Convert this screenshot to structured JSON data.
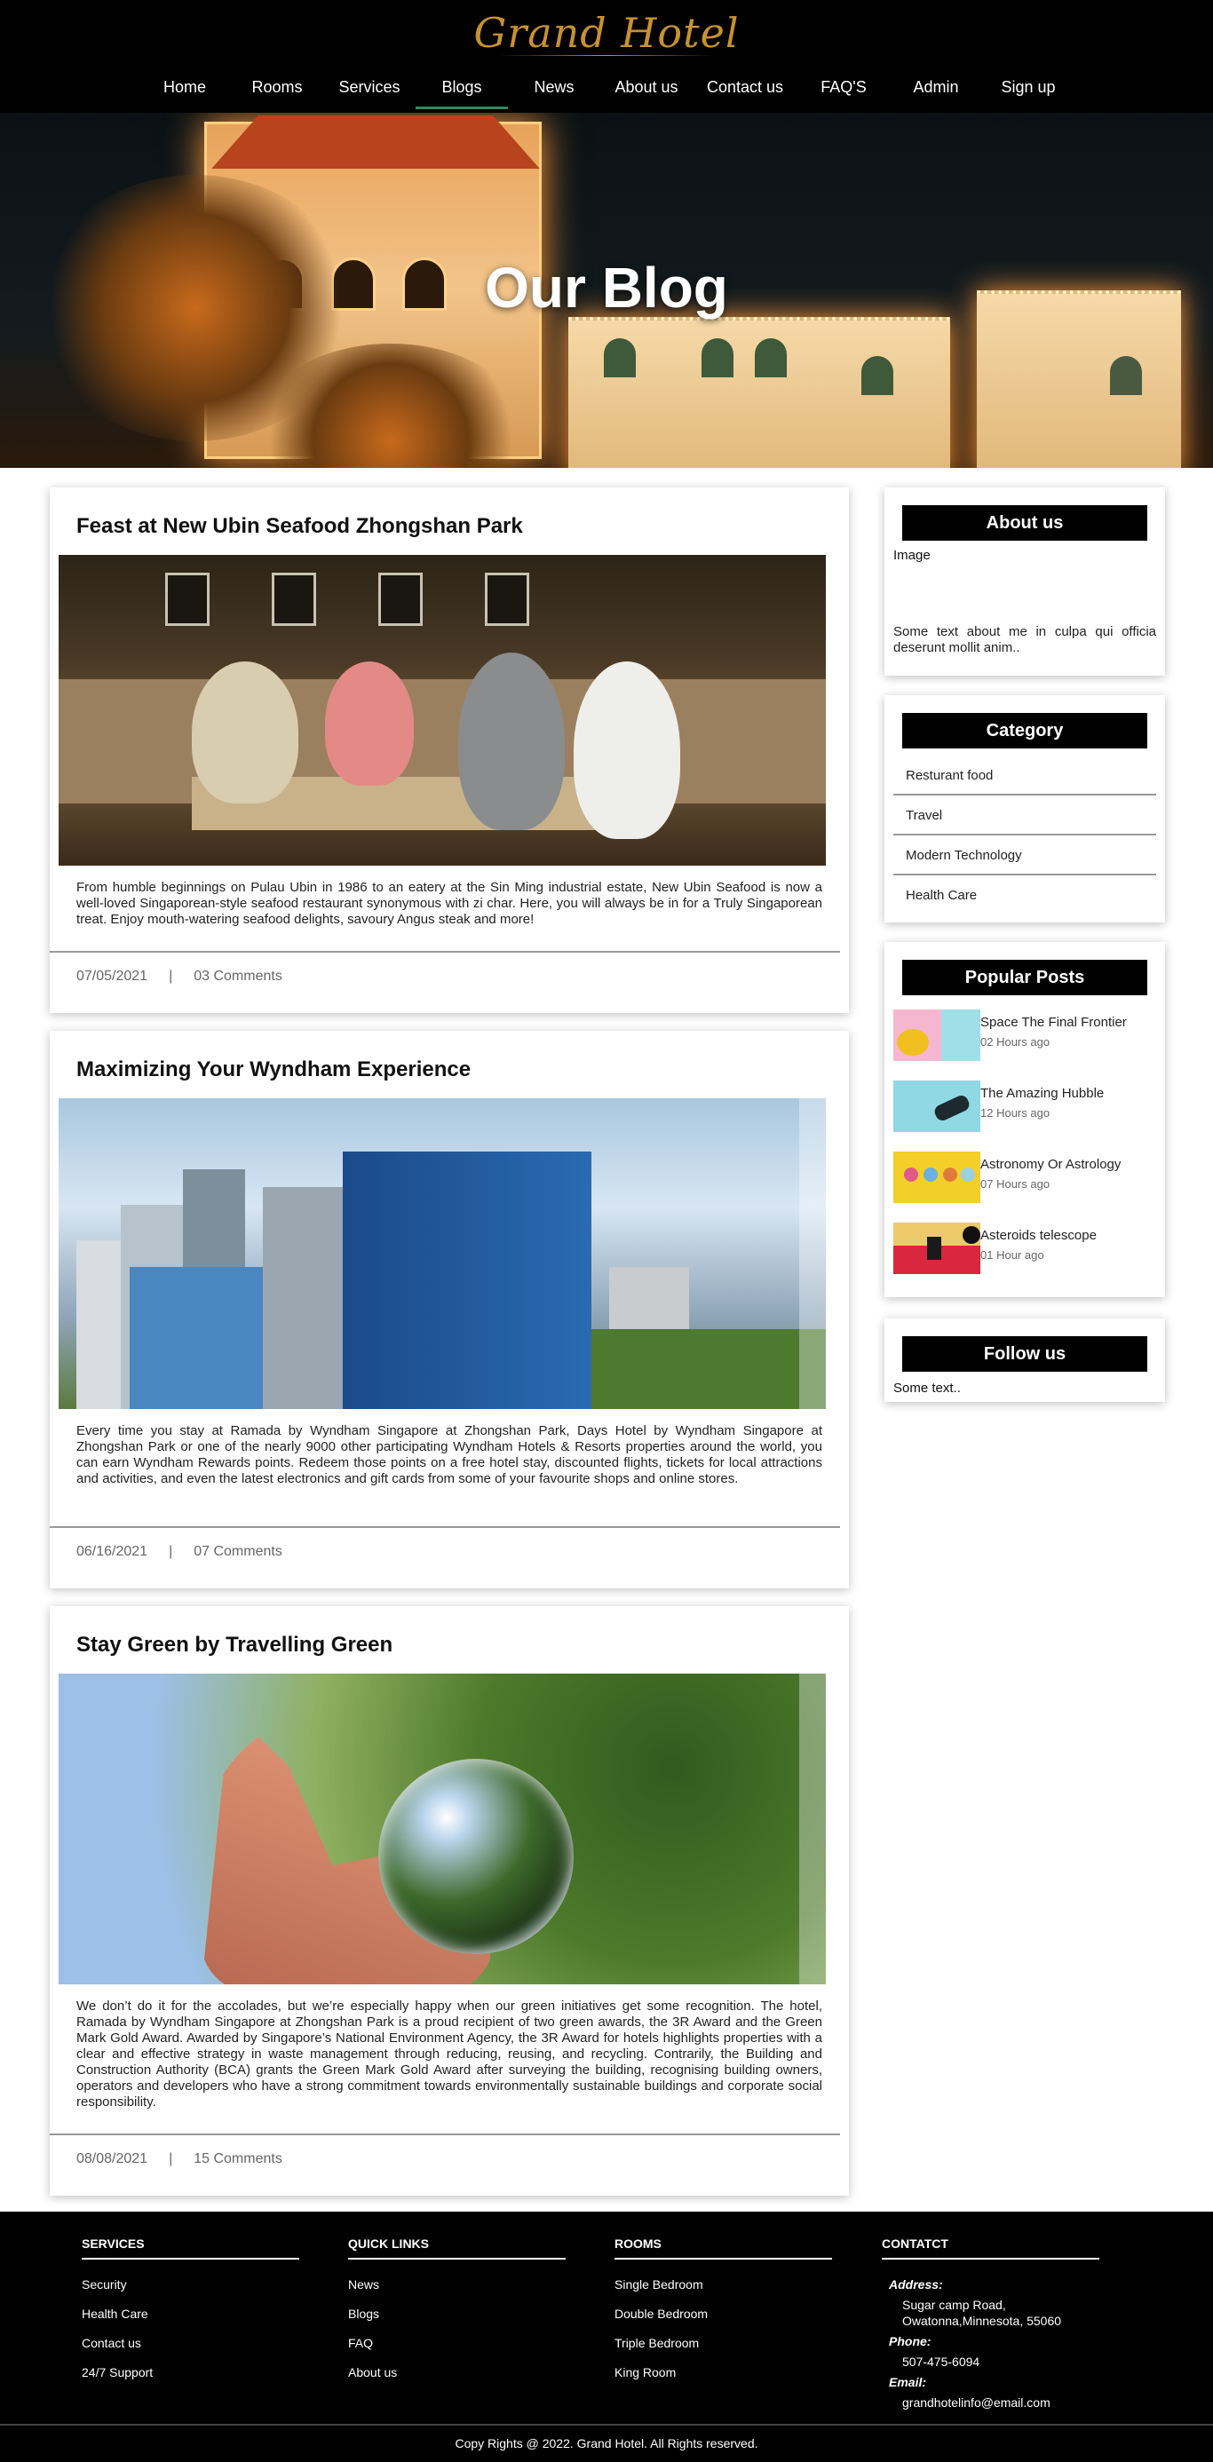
{
  "header": {
    "logo": "Grand Hotel",
    "nav": [
      "Home",
      "Rooms",
      "Services",
      "Blogs",
      "News",
      "About us",
      "Contact us",
      "FAQ'S",
      "Admin",
      "Sign up"
    ],
    "active_nav": "Blogs",
    "accent": "#2e8b57",
    "logo_color": "#c8912f"
  },
  "hero": {
    "title": "Our Blog"
  },
  "posts": [
    {
      "title": "Feast at New Ubin Seafood Zhongshan Park",
      "image_icon": "restaurant-dining-photo",
      "text": "From humble beginnings on Pulau Ubin in 1986 to an eatery at the Sin Ming industrial estate, New Ubin Seafood is now a well-loved Singaporean-style seafood restaurant synonymous with zi char. Here, you will always be in for a Truly Singaporean treat. Enjoy mouth-watering seafood delights, savoury Angus steak and more!",
      "date": "07/05/2021",
      "sep": "|",
      "comments": "03 Comments"
    },
    {
      "title": "Maximizing Your Wyndham Experience",
      "image_icon": "city-hotel-photo",
      "text": "Every time you stay at Ramada by Wyndham Singapore at Zhongshan Park, Days Hotel by Wyndham Singapore at Zhongshan Park or one of the nearly 9000 other participating Wyndham Hotels & Resorts properties around the world, you can earn Wyndham Rewards points. Redeem those points on a free hotel stay, discounted flights, tickets for local attractions and activities, and even the latest electronics and gift cards from some of your favourite shops and online stores.",
      "date": "06/16/2021",
      "sep": "|",
      "comments": "07 Comments"
    },
    {
      "title": "Stay Green by Travelling Green",
      "image_icon": "glass-ball-nature-photo",
      "text": "We don’t do it for the accolades, but we’re especially happy when our green initiatives get some recognition. The hotel, Ramada by Wyndham Singapore at Zhongshan Park is a proud recipient of two green awards, the 3R Award and the Green Mark Gold Award. Awarded by Singapore’s National Environment Agency, the 3R Award for hotels highlights properties with a clear and effective strategy in waste management through reducing, reusing, and recycling. Contrarily, the Building and Construction Authority (BCA) grants the Green Mark Gold Award after surveying the building, recognising building owners, operators and developers who have a strong commitment towards environmentally sustainable buildings and corporate social responsibility.",
      "date": "08/08/2021",
      "sep": "|",
      "comments": "15 Comments"
    }
  ],
  "sidebar": {
    "about": {
      "title": "About us",
      "image_label": "Image",
      "text": "Some text about me in culpa qui officia deserunt mollit anim.."
    },
    "category": {
      "title": "Category",
      "items": [
        "Resturant food",
        "Travel",
        "Modern Technology",
        "Health Care"
      ]
    },
    "popular": {
      "title": "Popular Posts",
      "items": [
        {
          "title": "Space The Final Frontier",
          "time": "02 Hours ago",
          "thumb": "desk-headphones-photo"
        },
        {
          "title": "The Amazing Hubble",
          "time": "12 Hours ago",
          "thumb": "car-toy-photo"
        },
        {
          "title": "Astronomy Or Astrology",
          "time": "07 Hours ago",
          "thumb": "lollipops-photo"
        },
        {
          "title": "Asteroids telescope",
          "time": "01 Hour ago",
          "thumb": "phone-flatlay-photo"
        }
      ]
    },
    "follow": {
      "title": "Follow us",
      "text": "Some text.."
    }
  },
  "footer": {
    "services": {
      "title": "SERVICES",
      "items": [
        "Security",
        "Health Care",
        "Contact us",
        "24/7 Support"
      ]
    },
    "quick_links": {
      "title": "QUICK LINKS",
      "items": [
        "News",
        "Blogs",
        "FAQ",
        "About us"
      ]
    },
    "rooms": {
      "title": "ROOMS",
      "items": [
        "Single Bedroom",
        "Double Bedroom",
        "Triple Bedroom",
        "King Room"
      ]
    },
    "contact": {
      "title": "CONTATCT",
      "address_label": "Address:",
      "address": "Sugar camp Road, Owatonna,Minnesota, 55060",
      "phone_label": "Phone:",
      "phone": "507-475-6094",
      "email_label": "Email:",
      "email": "grandhotelinfo@email.com"
    },
    "copyright": "Copy Rights @ 2022. Grand Hotel. All Rights reserved."
  }
}
